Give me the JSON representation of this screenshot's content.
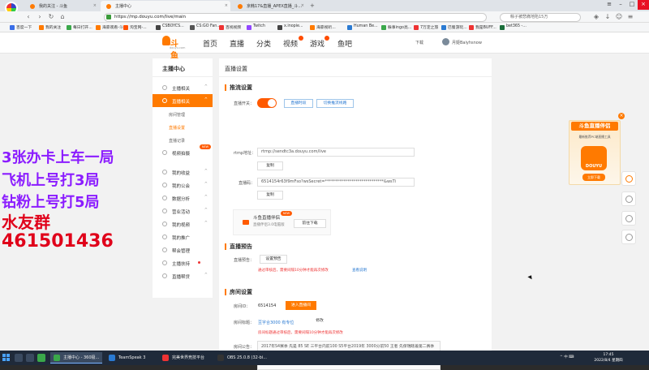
{
  "browser": {
    "tabs": [
      {
        "label": "我的关注 - 斗鱼",
        "active": false
      },
      {
        "label": "主播中心",
        "active": true
      },
      {
        "label": "京韩17&直播_APEX直播_斗...",
        "active": false
      }
    ],
    "url": "https://mp.douyu.com/live/main",
    "search_placeholder": "粽子被悲痛地陷15万",
    "bookmarks": [
      {
        "label": "百度一下",
        "color": "#3a6ee8"
      },
      {
        "label": "我的关注",
        "color": "#ff7a00"
      },
      {
        "label": "每日打开...",
        "color": "#3aa84a"
      },
      {
        "label": "海豪观看-斗...",
        "color": "#ff7a00"
      },
      {
        "label": "淘宝网-...",
        "color": "#ff5000"
      },
      {
        "label": "CSBOYCS...",
        "color": "#444"
      },
      {
        "label": "CS:GO Fan...",
        "color": "#555"
      },
      {
        "label": "百视视频",
        "color": "#e33"
      },
      {
        "label": "Twitch",
        "color": "#9146ff"
      },
      {
        "label": "x.inopie...",
        "color": "#444"
      },
      {
        "label": "海豪视听...",
        "color": "#ff7a00"
      },
      {
        "label": "Human Be...",
        "color": "#2a7ad2"
      },
      {
        "label": "躲事ingo亮...",
        "color": "#3aa84a"
      },
      {
        "label": "7万定之旅",
        "color": "#e33"
      },
      {
        "label": "巴蜀游玩...",
        "color": "#2a7ad2"
      },
      {
        "label": "我是BUFF...",
        "color": "#e33"
      },
      {
        "label": "bet365 -...",
        "color": "#1a6e3a"
      }
    ]
  },
  "header": {
    "logo_text": "斗鱼",
    "logo_sub": "douyu.com",
    "nav": [
      "首页",
      "直播",
      "分类",
      "视频",
      "游戏",
      "鱼吧"
    ],
    "download_label": "下载",
    "username": "月姬Baiyhsnow"
  },
  "sidebar": {
    "title": "主播中心",
    "items": [
      {
        "label": "主播相关",
        "arrow": "^"
      },
      {
        "label": "直播相关",
        "arrow": "^"
      },
      {
        "label": "视频拍摄",
        "arrow": ""
      },
      {
        "label": "我的收益",
        "arrow": "^"
      },
      {
        "label": "我的公会",
        "arrow": "^"
      },
      {
        "label": "数据分析",
        "arrow": "^"
      },
      {
        "label": "营业活动",
        "arrow": "^"
      },
      {
        "label": "我的视频",
        "arrow": "^"
      },
      {
        "label": "我的推广",
        "arrow": ""
      },
      {
        "label": "帮会管理",
        "arrow": ""
      },
      {
        "label": "主播扶持",
        "arrow": ""
      },
      {
        "label": "直播帮贷",
        "arrow": "^"
      }
    ],
    "subitems": [
      "房间管理",
      "直播设置",
      "直播记录"
    ],
    "new_tag": "NEW"
  },
  "main": {
    "title": "直播设置",
    "stream_section": "推流设置",
    "switch_label": "直播开关：",
    "switch_btn_a": "直播时段",
    "switch_btn_b": "切换推流线路",
    "rtmp_label": "rtmp地址：",
    "rtmp_value": "rtmp://sendtc3a.douyu.com/live",
    "copy_label": "复制",
    "key_label": "直播码：",
    "key_value": "6514154r63f9mFso?wsSecret=*****************************&wsTi",
    "helper_title": "斗鱼直播伴侣",
    "helper_sub": "直播伴侣3.0电脑版",
    "helper_new": "NEW",
    "helper_btn": "前往下载",
    "preview_section": "直播预告",
    "preview_label": "直播预告：",
    "preview_btn": "设置预告",
    "preview_warn": "通过审核后，需要间隔10分钟才能再次修改",
    "preview_link": "查看说明",
    "room_section": "房间设置",
    "room_id_label": "房间ID：",
    "room_id": "6514154",
    "room_id_btn": "进入直播间",
    "room_name_label": "房间标题：",
    "room_name": "豆字合3000 有专位",
    "edit_label": "修改",
    "room_name_warn": "房间标题通过审核后，需要间隔10分钟才能再次修改",
    "notice_label": "房间公告：",
    "notice_text": "2017年S4赛季 先是 85 SE 三平台内前100 S5平台2019年 3000分前50 王者 先保瑞瞎着第二赛季前10 faceit 亚洲10强 2500分 SEPL选手 破不知名 直播找打击打过职业选手"
  },
  "overlay": {
    "line1": "3张办卡上车一局",
    "line2": "飞机上号打3局",
    "line3": "钻粉上号打5局",
    "line4": "水友群",
    "line5": "461501436"
  },
  "ad": {
    "close": "×",
    "title": "斗鱼直播伴侣",
    "sub": "最新推荐PC端直播工具",
    "logo": "DOUYU",
    "btn": "立即下载"
  },
  "taskbar": {
    "apps": [
      {
        "label": "主播中心 - 360极...",
        "color": "#3aa84a"
      },
      {
        "label": "TeamSpeak 3",
        "color": "#2a7ad2"
      },
      {
        "label": "完美世界竞技平台",
        "color": "#e33"
      },
      {
        "label": "OBS 25.0.8 (32-bi...",
        "color": "#333"
      }
    ],
    "tray": "^ 中 ⌨",
    "time": "17:45",
    "date": "2022/8/4 星期四"
  }
}
